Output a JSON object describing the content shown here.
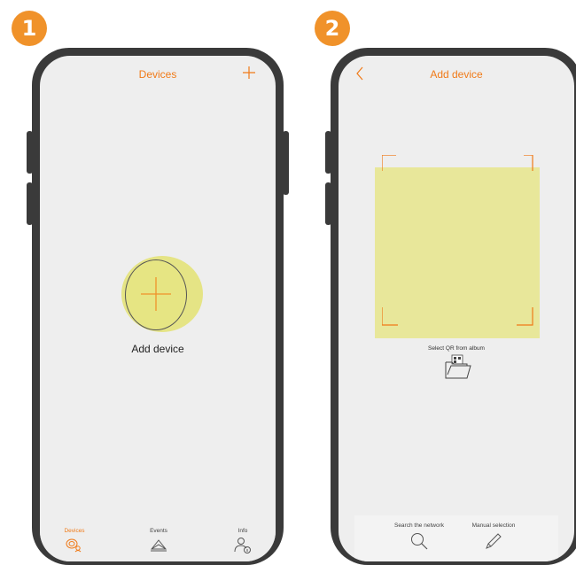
{
  "steps": [
    "1",
    "2"
  ],
  "screen1": {
    "title": "Devices",
    "add_label": "Add device",
    "tabs": [
      {
        "label": "Devices",
        "icon": "devices-icon",
        "active": true
      },
      {
        "label": "Events",
        "icon": "events-icon",
        "active": false
      },
      {
        "label": "Info",
        "icon": "info-icon",
        "active": false
      }
    ]
  },
  "screen2": {
    "title": "Add device",
    "album_label": "Select QR from album",
    "actions": [
      {
        "label": "Search the network",
        "icon": "search-icon"
      },
      {
        "label": "Manual selection",
        "icon": "pencil-icon"
      }
    ]
  },
  "colors": {
    "accent": "#F07A18",
    "badge": "#F0922A",
    "highlight": "#E8E79A",
    "phone": "#3a3a3a"
  }
}
